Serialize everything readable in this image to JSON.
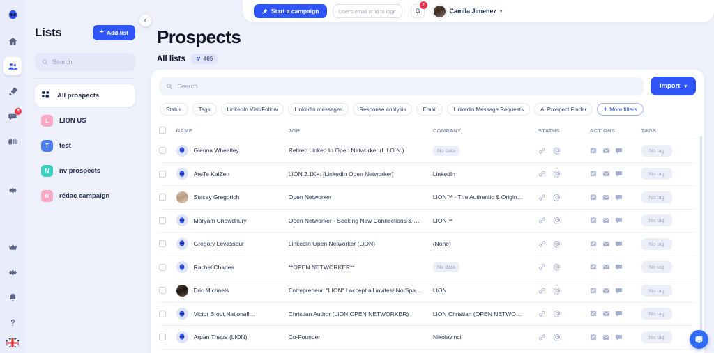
{
  "rail": {
    "logo_icon": "alien-logo-icon",
    "items": [
      {
        "name": "home",
        "icon": "home-icon",
        "active": false,
        "badge": null
      },
      {
        "name": "prospects",
        "icon": "people-icon",
        "active": true,
        "badge": null
      },
      {
        "name": "campaigns",
        "icon": "rocket-icon",
        "active": false,
        "badge": null
      },
      {
        "name": "inbox",
        "icon": "chat-icon",
        "active": false,
        "badge": "4"
      },
      {
        "name": "teams",
        "icon": "group-icon",
        "active": false,
        "badge": null
      },
      {
        "name": "settings-mid",
        "icon": "gear-icon",
        "active": false,
        "badge": null
      }
    ],
    "bottom": [
      {
        "name": "upgrade",
        "icon": "crown-icon"
      },
      {
        "name": "settings",
        "icon": "gear-icon"
      },
      {
        "name": "notifications",
        "icon": "bell-icon"
      },
      {
        "name": "help",
        "icon": "question-icon"
      }
    ],
    "language_flag": "uk-flag-icon"
  },
  "sidebar": {
    "title": "Lists",
    "add_list_label": "Add list",
    "search_placeholder": "Search",
    "search_value": "",
    "collapse_icon": "chevron-left-icon",
    "items": [
      {
        "label": "All prospects",
        "icon": "grid-icon",
        "active": true,
        "initial": null,
        "color": null
      },
      {
        "label": "LION US",
        "initial": "L",
        "color": "#f7a8c4",
        "active": false
      },
      {
        "label": "test",
        "initial": "T",
        "color": "#4a7ef0",
        "active": false
      },
      {
        "label": "nv prospects",
        "initial": "N",
        "color": "#3ed0c0",
        "active": false
      },
      {
        "label": "rédac campaign",
        "initial": "R",
        "color": "#f7a8c4",
        "active": false
      }
    ]
  },
  "topbar": {
    "campaign_button": "Start a campaign",
    "campaign_icon": "rocket-icon",
    "login_placeholder": "User's email or id to login",
    "login_value": "",
    "bell_icon": "bell-icon",
    "bell_badge": "2",
    "user_name": "Camila Jimenez",
    "caret_icon": "chevron-down-icon"
  },
  "page": {
    "title": "Prospects",
    "subtitle": "All lists",
    "count": "405",
    "count_icon": "list-dot-icon"
  },
  "toolbar": {
    "search_placeholder": "Search",
    "search_value": "",
    "search_icon": "search-icon",
    "import_label": "Import",
    "import_caret": "chevron-down-icon",
    "filters": [
      "Status",
      "Tags",
      "LinkedIn Visit/Follow",
      "LinkedIn messages",
      "Response analysis",
      "Email",
      "Linkedin Message Requests",
      "AI Prospect Finder"
    ],
    "more_filters_label": "More filters"
  },
  "table": {
    "columns": [
      "NAME",
      "JOB",
      "COMPANY",
      "STATUS",
      "ACTIONS",
      "TAGS"
    ],
    "no_data_label": "No data",
    "no_tag_label": "No tag",
    "row_icons": {
      "link": "link-icon",
      "at": "at-icon",
      "note": "note-icon",
      "mail": "mail-icon",
      "message": "message-icon"
    },
    "rows": [
      {
        "name": "Glenna Wheatley",
        "avatar": "alien",
        "job": "Retired Linked In Open Networker (L.I.O.N.)",
        "company": "",
        "company_empty": true,
        "tag": "No tag"
      },
      {
        "name": "AreTe KaiZen",
        "avatar": "alien",
        "job": "LION 2.1K+: [LinkedIn Open Networker]",
        "company": "LinkedIn",
        "company_empty": false,
        "tag": "No tag"
      },
      {
        "name": "Stacey Gregorich",
        "avatar": "photo-a",
        "job": "Open Networker",
        "company": "LION™ - The Authentic & Origin…",
        "company_empty": false,
        "tag": "No tag"
      },
      {
        "name": "Maryam Chowdhury",
        "avatar": "alien",
        "job": "Open Networker - Seeking New Connections & …",
        "company": "LION™",
        "company_empty": false,
        "tag": "No tag"
      },
      {
        "name": "Gregory Levasseur",
        "avatar": "alien",
        "job": "LinkedIn Open Networker (LION)",
        "company": "(None)",
        "company_empty": false,
        "tag": "No tag"
      },
      {
        "name": "Rachel Charles",
        "avatar": "alien",
        "job": "**OPEN NETWORKER**",
        "company": "",
        "company_empty": true,
        "tag": "No tag"
      },
      {
        "name": "Eric Michaels",
        "avatar": "photo-b",
        "job": "Entrepreneur. \"LION\" I accept all invites! No Spa…",
        "company": "LION",
        "company_empty": false,
        "tag": "No tag"
      },
      {
        "name": "Victor Brodt Nationall…",
        "avatar": "alien",
        "job": "Christian Author (LION OPEN NETWORKER) .",
        "company": "LION Christian (OPEN NETWO…",
        "company_empty": false,
        "tag": "No tag"
      },
      {
        "name": "Arpan Thapa (LION)",
        "avatar": "alien",
        "job": "Co-Founder",
        "company": "Nikolavinci",
        "company_empty": false,
        "tag": "No tag"
      }
    ]
  },
  "chat_widget": {
    "icon": "chat-bubble-icon"
  },
  "colors": {
    "accent": "#2f55f7",
    "page_bg": "#eef0fb",
    "badge_red": "#f4354a"
  }
}
